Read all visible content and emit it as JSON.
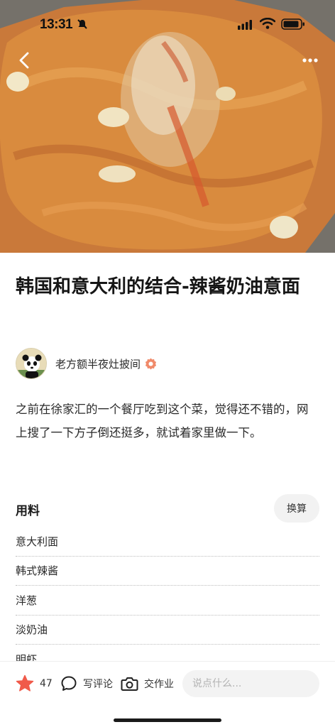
{
  "status_bar": {
    "time": "13:31"
  },
  "recipe": {
    "title": "韩国和意大利的结合-辣酱奶油意面",
    "author": {
      "name": "老方额半夜灶披间"
    },
    "description": "之前在徐家汇的一个餐厅吃到这个菜，觉得还不错的，网上搜了一下方子倒还挺多，就试着家里做一下。"
  },
  "ingredients": {
    "header": "用料",
    "convert_label": "换算",
    "items": [
      {
        "name": "意大利面"
      },
      {
        "name": "韩式辣酱"
      },
      {
        "name": "洋葱"
      },
      {
        "name": "淡奶油"
      },
      {
        "name": "明虾"
      }
    ]
  },
  "bottom_bar": {
    "favorite_count": "47",
    "comment_label": "写评论",
    "homework_label": "交作业",
    "input_placeholder": "说点什么..."
  },
  "colors": {
    "accent": "#f05a4a",
    "hero_sauce": "#d98b3e"
  }
}
